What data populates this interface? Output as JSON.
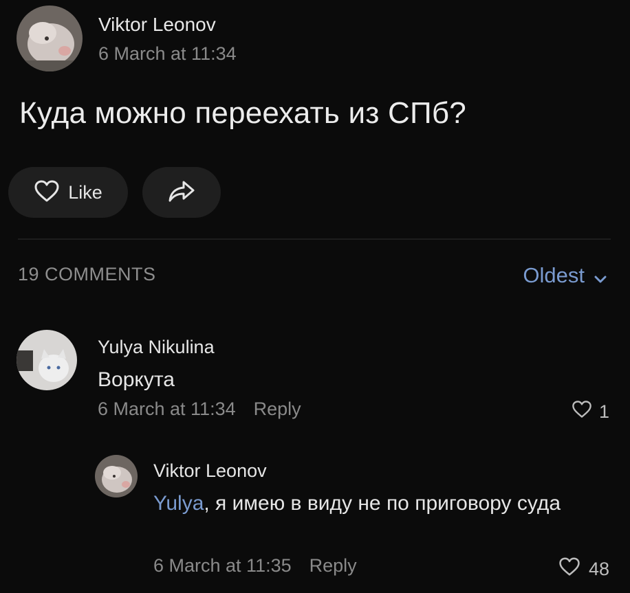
{
  "post": {
    "author": "Viktor Leonov",
    "date": "6 March at 11:34",
    "text": "Куда можно переехать из СПб?",
    "like_label": "Like",
    "avatar_icon": "pig-avatar",
    "share_icon": "share-icon"
  },
  "comments_section": {
    "count_label": "19 COMMENTS",
    "sort_label": "Oldest"
  },
  "comments": [
    {
      "author": "Yulya Nikulina",
      "text": "Воркута",
      "date": "6 March at 11:34",
      "reply_label": "Reply",
      "likes": "1",
      "avatar_icon": "cat-avatar"
    },
    {
      "author": "Viktor Leonov",
      "mention": "Yulya",
      "text": ", я имею в виду не по приговору суда",
      "date": "6 March at 11:35",
      "reply_label": "Reply",
      "likes": "48",
      "avatar_icon": "pig-avatar"
    }
  ],
  "colors": {
    "background": "#0b0b0b",
    "accent": "#7a9bd0",
    "muted": "#8a8a8a",
    "pill": "#1f1f1f"
  }
}
